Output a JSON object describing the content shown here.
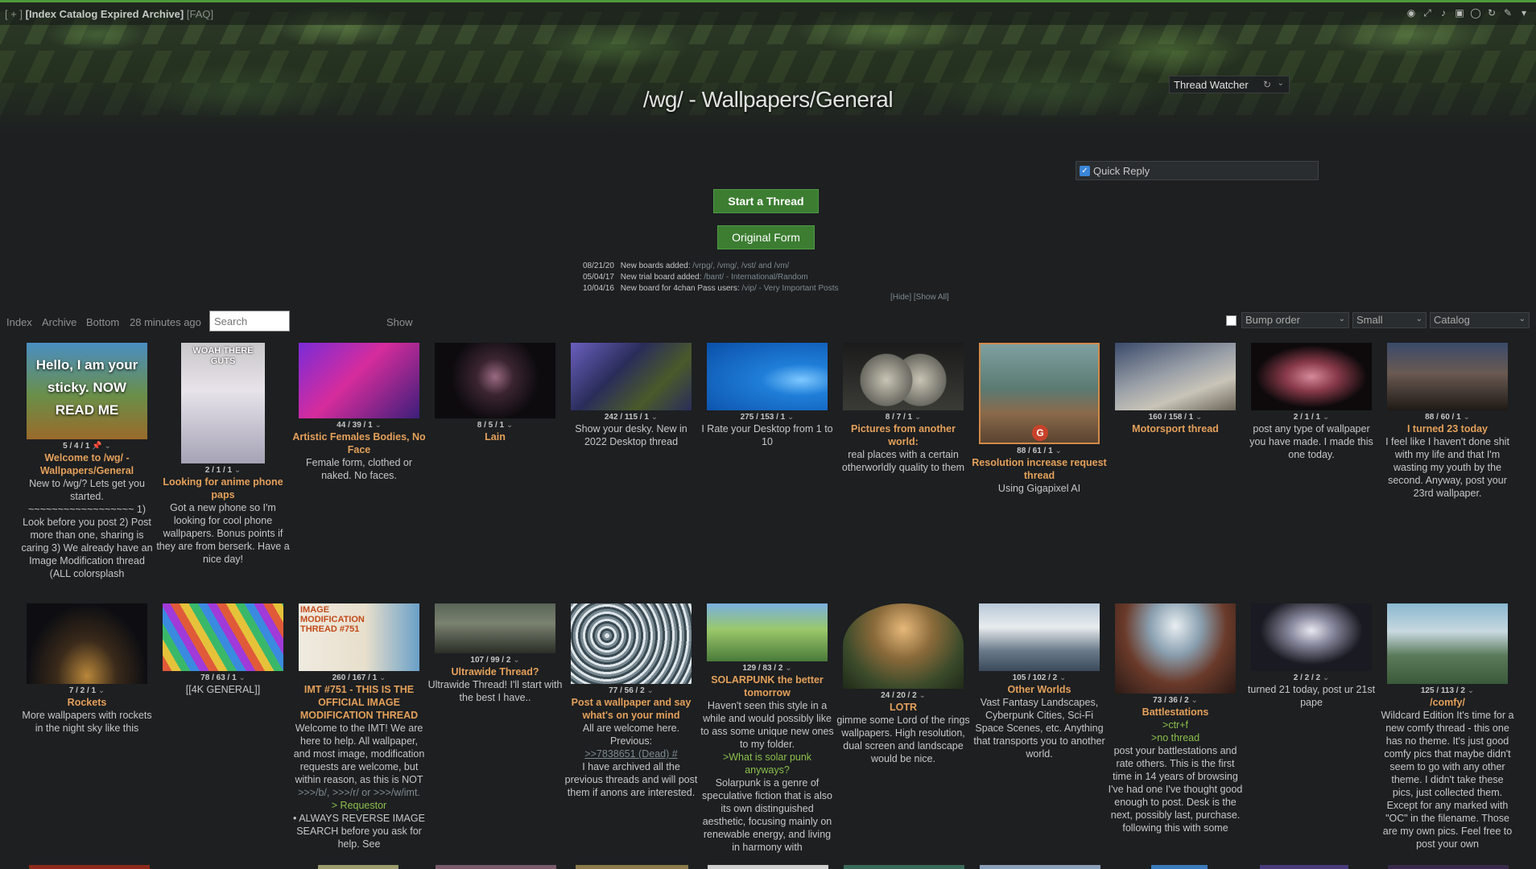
{
  "nav": {
    "plus": "[ + ]",
    "links": [
      "[Index",
      "Catalog",
      "Expired",
      "Archive]"
    ],
    "faq": "[FAQ]"
  },
  "board_title": "/wg/ - Wallpapers/General",
  "thread_watcher": {
    "label": "Thread Watcher"
  },
  "quick_reply": {
    "label": "Quick Reply",
    "checked": true
  },
  "buttons": {
    "start_thread": "Start a Thread",
    "original_form": "Original Form"
  },
  "news": [
    {
      "date": "08/21/20",
      "text": "New boards added:",
      "links": "/vrpg/, /vmg/, /vst/ and /vm/"
    },
    {
      "date": "05/04/17",
      "text": "New trial board added:",
      "links": "/bant/ - International/Random"
    },
    {
      "date": "10/04/16",
      "text": "New board for 4chan Pass users:",
      "links": "/vip/ - Very Important Posts"
    }
  ],
  "news_hide": "[Hide]",
  "news_showall": "[Show All]",
  "toolbar": {
    "index": "Index",
    "archive": "Archive",
    "bottom": "Bottom",
    "updated": "28 minutes ago",
    "search_placeholder": "Search",
    "show": "Show",
    "sort": "Bump order",
    "size": "Small",
    "view": "Catalog"
  },
  "threads": [
    {
      "meta": "5 / 4 / 1",
      "subject": "Welcome to /wg/ - Wallpapers/General",
      "teaser": "New to /wg/? Lets get you started. ~~~~~~~~~~~~~~~~~~ 1) Look before you post 2) Post more than one, sharing is caring 3) We already have an Image Modification thread (ALL colorsplash",
      "thumb_text": "Hello, I am your sticky. NOW READ ME"
    },
    {
      "meta": "2 / 1 / 1",
      "subject": "Looking for anime phone paps",
      "teaser": "Got a new phone so I'm looking for cool phone wallpapers. Bonus points if they are from berserk. Have a nice day!",
      "thumb_text": "WOAH THERE GUTS"
    },
    {
      "meta": "44 / 39 / 1",
      "subject": "Artistic Females Bodies, No Face",
      "teaser": "Female form, clothed or naked. No faces.",
      "thumb_text": ""
    },
    {
      "meta": "8 / 5 / 1",
      "subject": "Lain",
      "teaser": "",
      "thumb_text": ""
    },
    {
      "meta": "242 / 115 / 1",
      "subject": "",
      "teaser": "Show your desky. New in 2022 Desktop thread",
      "thumb_text": ""
    },
    {
      "meta": "275 / 153 / 1",
      "subject": "",
      "teaser": "I Rate your Desktop from 1 to 10",
      "thumb_text": ""
    },
    {
      "meta": "8 / 7 / 1",
      "subject": "Pictures from another world:",
      "teaser": "real places with a certain otherworldly quality to them",
      "thumb_text": ""
    },
    {
      "meta": "88 / 61 / 1",
      "subject": "Resolution increase request thread",
      "teaser": "Using Gigapixel AI",
      "thumb_text": "G"
    },
    {
      "meta": "160 / 158 / 1",
      "subject": "Motorsport thread",
      "teaser": "",
      "thumb_text": ""
    },
    {
      "meta": "2 / 1 / 1",
      "subject": "",
      "teaser": "post any type of wallpaper you have made. I made this one today.",
      "thumb_text": ""
    },
    {
      "meta": "88 / 60 / 1",
      "subject": "I turned 23 today",
      "teaser": "I feel like I haven't done shit with my life and that I'm wasting my youth by the second. Anyway, post your 23rd wallpaper.",
      "thumb_text": ""
    },
    {
      "meta": "7 / 2 / 1",
      "subject": "Rockets",
      "teaser": "More wallpapers with rockets in the night sky like this",
      "thumb_text": ""
    },
    {
      "meta": "78 / 63 / 1",
      "subject": "",
      "teaser": "[[4K GENERAL]]",
      "thumb_text": ""
    },
    {
      "meta": "260 / 167 / 1",
      "subject": "IMT #751 - THIS IS THE OFFICIAL IMAGE MODIFICATION THREAD",
      "teaser": "Welcome to the IMT! We are here to help. All wallpaper, and most image, modification requests are welcome, but within reason, as this is NOT",
      "quote": ">>>/b/, >>>/r/ or >>>/w/imt.",
      "greentext": "> Requestor",
      "teaser2": "• ALWAYS REVERSE IMAGE SEARCH before you ask for help. See",
      "thumb_text": "IMAGE MODIFICATION THREAD #751"
    },
    {
      "meta": "107 / 99 / 2",
      "subject": "Ultrawide Thread?",
      "teaser": "Ultrawide Thread! I'll start with the best I have..",
      "thumb_text": ""
    },
    {
      "meta": "77 / 56 / 2",
      "subject": "Post a wallpaper and say what's on your mind",
      "teaser": "All are welcome here. Previous:",
      "quote": ">>7838651 (Dead) #",
      "teaser2": "I have archived all the previous threads and will post them if anons are interested.",
      "thumb_text": ""
    },
    {
      "meta": "129 / 83 / 2",
      "subject": "SOLARPUNK the better tomorrow",
      "teaser": "Haven't seen this style in a while and would possibly like to ass some unique new ones to my folder.",
      "greentext": ">What is solar punk anyways?",
      "teaser2": "Solarpunk is a genre of speculative fiction that is also its own distinguished aesthetic, focusing mainly on renewable energy, and living in harmony with",
      "thumb_text": ""
    },
    {
      "meta": "24 / 20 / 2",
      "subject": "LOTR",
      "teaser": "gimme some Lord of the rings wallpapers. High resolution, dual screen and landscape would be nice.",
      "thumb_text": ""
    },
    {
      "meta": "105 / 102 / 2",
      "subject": "Other Worlds",
      "teaser": "Vast Fantasy Landscapes, Cyberpunk Cities, Sci-Fi Space Scenes, etc. Anything that transports you to another world.",
      "thumb_text": ""
    },
    {
      "meta": "73 / 36 / 2",
      "subject": "Battlestations",
      "greentext": ">ctr+f",
      "greentext2": ">no thread",
      "teaser": "post your battlestations and rate others. This is the first time in 14 years of browsing I've had one I've thought good enough to post. Desk is the next, possibly last, purchase. following this with some",
      "thumb_text": ""
    },
    {
      "meta": "2 / 2 / 2",
      "subject": "",
      "teaser": "turned 21 today, post ur 21st pape",
      "thumb_text": ""
    },
    {
      "meta": "125 / 113 / 2",
      "subject": "/comfy/",
      "teaser": "Wildcard Edition It's time for a new comfy thread - this one has no theme. It's just good comfy pics that maybe didn't seem to go with any other theme. I didn't take these pics, just collected them. Except for any marked with \"OC\" in the filename. Those are my own pics. Feel free to post your own",
      "thumb_text": ""
    }
  ],
  "colors": {
    "accent": "#4e9a3a",
    "subject": "#e4a05a",
    "background": "#1d1f21",
    "greentext": "#8bbf4b"
  }
}
